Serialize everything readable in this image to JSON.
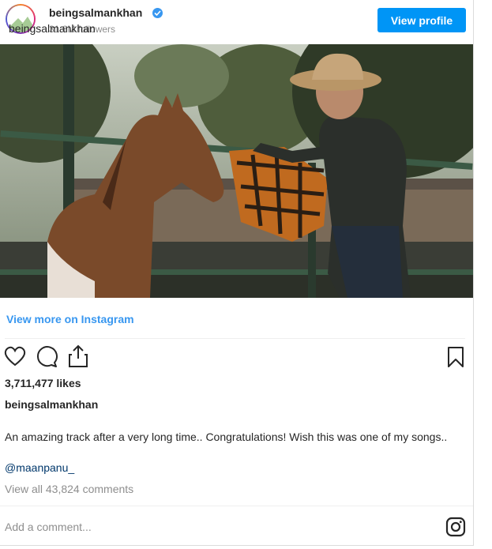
{
  "header": {
    "username": "beingsalmankhan",
    "avatar_alt": "beingsalmankhan",
    "followers": "31.6M followers",
    "view_profile_label": "View profile"
  },
  "post": {
    "image_description": "Man in cowboy hat standing beside a brown horse at a fence",
    "view_more_label": "View more on Instagram",
    "likes": "3,711,477 likes",
    "caption_username": "beingsalmankhan",
    "comment_text": "An amazing track after a very long time.. Congratulations! Wish this was one of my songs..",
    "mention": "@maanpanu_",
    "view_all_comments": "View all 43,824 comments",
    "add_comment_placeholder": "Add a comment..."
  },
  "icons": {
    "like": "heart-icon",
    "comment": "comment-bubble-icon",
    "share": "share-icon",
    "save": "bookmark-icon",
    "instagram": "instagram-logo-icon",
    "verified": "verified-badge-icon"
  },
  "colors": {
    "accent": "#0095f6",
    "link": "#3897f0",
    "muted": "#8e8e8e",
    "mention": "#00376b"
  }
}
